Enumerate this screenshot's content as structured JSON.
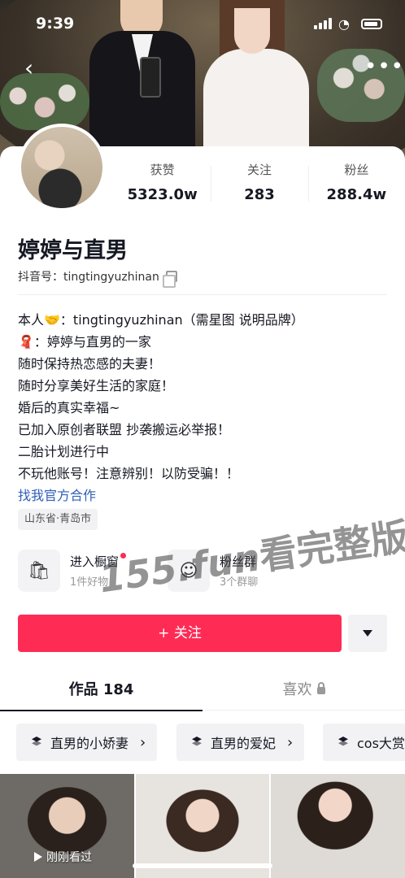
{
  "status_bar": {
    "time": "9:39"
  },
  "profile": {
    "stats": [
      {
        "label": "获赞",
        "value": "5323.0w"
      },
      {
        "label": "关注",
        "value": "283"
      },
      {
        "label": "粉丝",
        "value": "288.4w"
      }
    ],
    "name": "婷婷与直男",
    "douyin_id": "抖音号：tingtingyuzhinan",
    "bio_lines": [
      "本人🤝：tingtingyuzhinan（需星图 说明品牌）",
      "🧣：婷婷与直男的一家",
      "随时保持热恋感的夫妻！",
      "随时分享美好生活的家庭！",
      "婚后的真实幸福~",
      "已加入原创者联盟 抄袭搬运必举报！",
      "二胎计划进行中",
      "不玩他账号！注意辨别！以防受骗！！"
    ],
    "official_link": "找我官方合作",
    "location": "山东省·青岛市"
  },
  "entries": {
    "shop": {
      "title": "进入橱窗",
      "subtitle": "1件好物"
    },
    "fan_group": {
      "title": "粉丝群",
      "subtitle": "3个群聊"
    }
  },
  "watermark": {
    "site": "155.fun",
    "text": "看完整版"
  },
  "actions": {
    "follow_label": "+ 关注"
  },
  "tabs": [
    {
      "label": "作品 184"
    },
    {
      "label": "喜欢"
    }
  ],
  "collections": [
    {
      "label": "直男的小娇妻"
    },
    {
      "label": "直男的爱妃"
    },
    {
      "label": "cos大赏"
    }
  ],
  "videos": [
    {
      "tag": "刚刚看过"
    }
  ]
}
